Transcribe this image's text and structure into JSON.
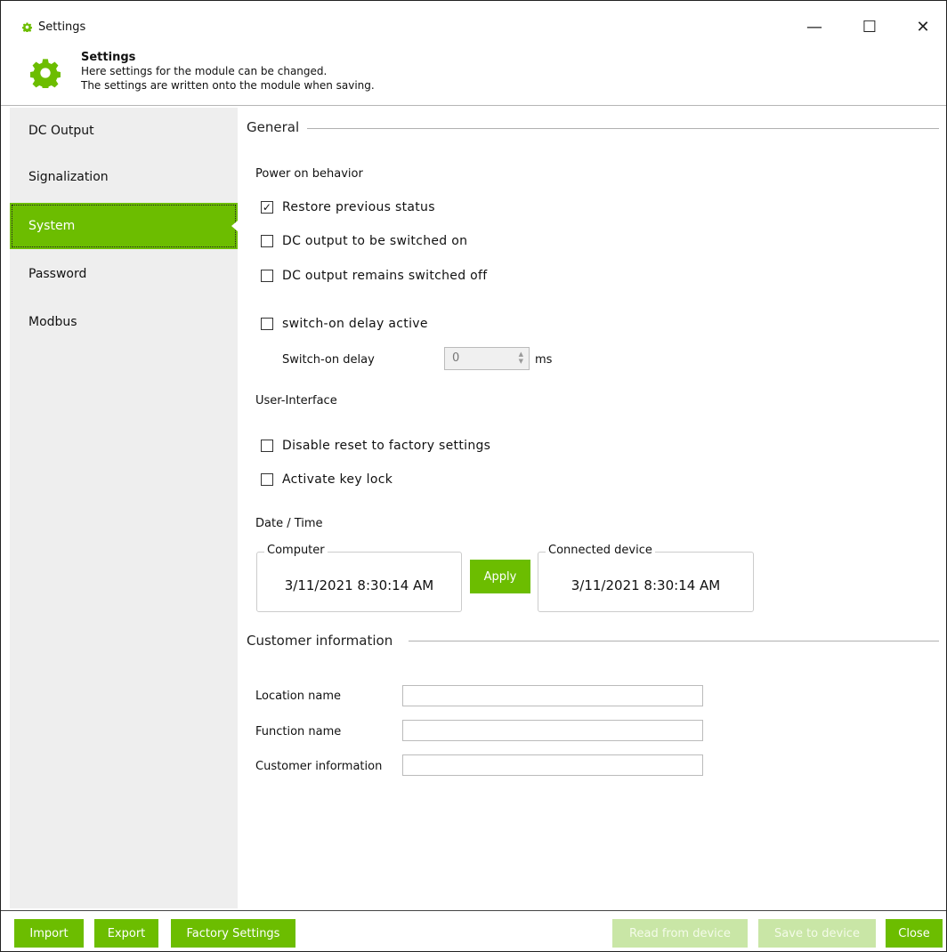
{
  "window": {
    "title": "Settings",
    "minimize": "—",
    "maximize": "☐",
    "close": "✕"
  },
  "header": {
    "title": "Settings",
    "line1": "Here settings for the module can be changed.",
    "line2": "The settings are written onto the module when saving."
  },
  "colors": {
    "accent": "#6cbd00",
    "accent_disabled": "#c9e6a6",
    "sidebar_bg": "#eeeeee"
  },
  "sidebar": {
    "items": [
      {
        "label": "DC Output",
        "active": false
      },
      {
        "label": "Signalization",
        "active": false
      },
      {
        "label": "System",
        "active": true
      },
      {
        "label": "Password",
        "active": false
      },
      {
        "label": "Modbus",
        "active": false
      }
    ]
  },
  "general": {
    "title": "General",
    "power_on_label": "Power on behavior",
    "options": [
      {
        "label": "Restore previous status",
        "checked": true
      },
      {
        "label": "DC output to be switched on",
        "checked": false
      },
      {
        "label": "DC output remains switched off",
        "checked": false
      }
    ],
    "switch_on_delay_active": {
      "label": "switch-on delay active",
      "checked": false
    },
    "switch_on_delay": {
      "label": "Switch-on delay",
      "value": "0",
      "unit": "ms"
    },
    "ui_label": "User-Interface",
    "ui_options": [
      {
        "label": "Disable reset to factory settings",
        "checked": false
      },
      {
        "label": "Activate key lock",
        "checked": false
      }
    ],
    "datetime": {
      "label": "Date / Time",
      "computer_legend": "Computer",
      "computer_value": "3/11/2021 8:30:14 AM",
      "apply_label": "Apply",
      "device_legend": "Connected device",
      "device_value": "3/11/2021 8:30:14 AM"
    }
  },
  "customer": {
    "title": "Customer information",
    "fields": [
      {
        "label": "Location name",
        "value": ""
      },
      {
        "label": "Function name",
        "value": ""
      },
      {
        "label": "Customer information",
        "value": ""
      }
    ]
  },
  "footer": {
    "import": "Import",
    "export": "Export",
    "factory": "Factory Settings",
    "read": "Read from device",
    "save": "Save to device",
    "close": "Close"
  },
  "icons": {
    "app": "gear-icon",
    "header": "gear-icon"
  }
}
